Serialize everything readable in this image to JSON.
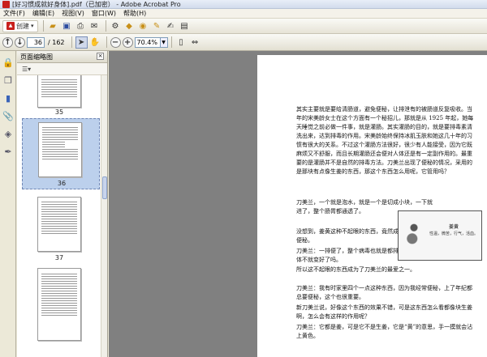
{
  "window": {
    "title": "[好习惯成就好身体].pdf（已加密） - Adobe Acrobat Pro"
  },
  "menu": [
    "文件(F)",
    "编辑(E)",
    "视图(V)",
    "窗口(W)",
    "帮助(H)"
  ],
  "toolbar": {
    "create_label": "创建",
    "create_caret": "▾",
    "page_current": "36",
    "page_total": "/ 162",
    "zoom_value": "70.4%"
  },
  "nav": {
    "header": "页面缩略图",
    "close": "×",
    "options_label": "☰▾",
    "thumbnails": [
      {
        "number": "35"
      },
      {
        "number": "36"
      },
      {
        "number": "37"
      },
      {
        "number": ""
      }
    ]
  },
  "document": {
    "paragraphs": [
      "其实主要就是要给清肠道，避免便秘，让排泄有的被肠道反复吸收。当年的宋美龄女士在这个方面有一个秘招儿，那就是从 1925 年起，她每天睡觉之前必做一件事，就是灌肠。其实灌肠的目的，就是要排毒素清洗出来，达到排毒的作用。宋美龄始终保持冰肌玉肤和她这几十年的习惯有很大的关系。不过这个灌肠方法很好，很少有人能接受，因为它既麻烦又不舒服，而且长期灌肠还会便对人体还是有一定副作用的。最重要的是灌肠并不是自然的排毒方法。刀美兰出现了便秘的情况，采用的是那块有点像生姜的东西，那这个东西怎么用呢，它管用吗？",
      "刀美兰，一个就是泡水，就是一个是切成小块，一下就进了，整个肠胃都通透了。",
      "没想到，姜黄这种不起眼的东西，竟然成为刀美兰治疗便秘。",
      "刀美兰：一排便了，整个病毒也就是都排了，大便一好，小便一好，身体不就变好了吗。",
      "所以这不起眼的东西成为了刀美兰的最爱之一。",
      "刀美兰：我有时家里四个一点这种东西，因为我经常便秘，上了年纪都总要便秘，这个也很重要。",
      "新刀美兰说，好像这个东西的效果不错，可是这东西怎么看都像块生姜啊，怎么会有这样的作用呢？",
      "刀美兰：它都是姜，可是它不是生姜，它是“黄”的意思，手一摸就会沾上黄色。"
    ],
    "figure": {
      "caption_title": "姜黄",
      "caption_sub": "性温，微苦，行气，活血。"
    }
  }
}
